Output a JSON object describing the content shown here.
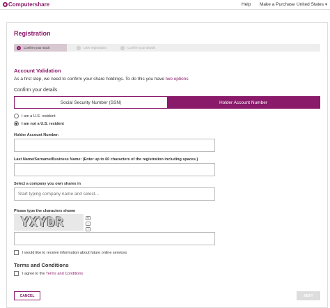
{
  "header": {
    "logo_text": "Computershare",
    "nav": {
      "help": "Help",
      "make_purchase": "Make a Purchase",
      "country": "United States"
    }
  },
  "page": {
    "title": "Registration",
    "steps": [
      {
        "num": "1",
        "label": "Confirm your stock"
      },
      {
        "num": "2",
        "label": "User registration"
      },
      {
        "num": "3",
        "label": "Confirm your details"
      }
    ]
  },
  "validation": {
    "title": "Account Validation",
    "intro": "As a first step, we need to confirm your share holdings. To do this you have",
    "intro_link": "two options"
  },
  "confirm": {
    "title": "Confirm your details",
    "tabs": {
      "ssn": "Social Security Number (SSN)",
      "holder": "Holder Account Number"
    }
  },
  "residency": {
    "us_resident": "I am a U.S. resident",
    "non_resident": "I am not a U.S. resident",
    "selected": "non_resident"
  },
  "form": {
    "holder_account_label": "Holder Account Number:",
    "holder_account_value": "",
    "last_name_label": "Last Name/Surname/Business Name: (Enter up to 60 characters of the registration including spaces.)",
    "last_name_value": "",
    "company_label": "Select a company you own shares in",
    "company_placeholder": "Start typing company name and select...",
    "captcha_label": "Please type the characters shown",
    "captcha_text": "YXYDR",
    "captcha_value": "",
    "future_info": "I would like to receive information about future online services"
  },
  "terms": {
    "title": "Terms and Conditions",
    "agree_prefix": "I agree to the",
    "agree_link": "Terms and Conditions"
  },
  "buttons": {
    "cancel": "CANCEL",
    "next": "NEXT"
  }
}
